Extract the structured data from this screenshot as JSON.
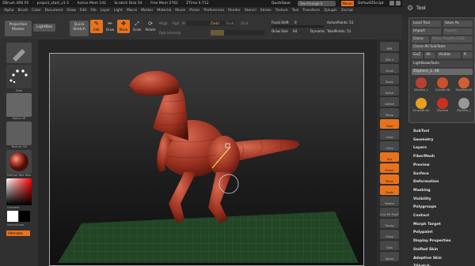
{
  "titlebar": {
    "app": "ZBrush 4R6 P2",
    "project": "project_start_v1-1",
    "active_mem": "Active Mem 142",
    "scratch_disk": "Scratch Disk 54",
    "free_mem": "Free Mem 2762",
    "ztime": "ZTime 0.712",
    "quicksave": "QuickSave",
    "see_through": "See-through 0",
    "menus": "Menus",
    "default_zscript": "DefaultZScript"
  },
  "menubar": [
    "Alpha",
    "Brush",
    "Color",
    "Document",
    "Draw",
    "Edit",
    "File",
    "Layer",
    "Light",
    "Macro",
    "Marker",
    "Material",
    "Movie",
    "Picker",
    "Preferences",
    "Render",
    "Stencil",
    "Stroke",
    "Texture",
    "Tool",
    "Transform",
    "Zplugin",
    "Zscript"
  ],
  "toolbar": {
    "projection_master": "Projection Master",
    "lightbox": "LightBox",
    "quick_sketch": "Quick Sketch",
    "edit": "Edit",
    "draw": "Draw",
    "move": "Move",
    "scale": "Scale",
    "rotate": "Rotate",
    "mrgb": "Mrgb",
    "rgb": "Rgb",
    "m": "M",
    "zadd": "Zadd",
    "zsub": "Zsub",
    "zcut": "Zcut",
    "rgb_intensity": "Rgb Intensity",
    "z_intensity": "Z Intensity",
    "z_intensity_value": 25,
    "focal_shift": "Focal Shift",
    "focal_shift_value": "0",
    "draw_size": "Draw Size",
    "draw_size_value": "64",
    "dynamic": "Dynamic",
    "active_points": "ActivePoints: 51",
    "total_points": "TotalPoints: 51"
  },
  "left": {
    "stroke_label": "Dots",
    "alpha_label": "Alpha Off",
    "texture_label": "Texture Off",
    "material_label": "MatCap Red Wax",
    "gradient": "Gradient",
    "switch_color": "SwitchColor",
    "alternate": "Alternate",
    "accent": "#e8721c"
  },
  "rightstrip": [
    "BPR",
    "SPix 3",
    "Scroll",
    "Zoom",
    "Actual",
    "AAHalf",
    "Persp",
    "Floor",
    "Local",
    "LSym",
    "Xyz",
    "Frame",
    "Move",
    "Scale",
    "Rotate",
    "Line Fill PolyF",
    "Transp",
    "Ghost",
    "Solo",
    "Xpose"
  ],
  "tool_panel": {
    "title": "Tool",
    "load_tool": "Load Tool",
    "save_as": "Save As",
    "import": "Import",
    "export": "Export",
    "clone": "Clone",
    "make_polymesh": "Make PolyMesh3D",
    "clone_all": "Clone All SubTools",
    "goz": "GoZ",
    "all": "All",
    "visible": "Visible",
    "r": "R",
    "lightbox_tools": "Lightbox▸Tools",
    "current_tool": "ZSphere_1. 48",
    "thumbs": [
      "ZSphere_1",
      "Cylinder3D",
      "PolyMesh3D",
      "SimpleBrush",
      "ZSphere",
      "ZSphere_1"
    ],
    "menu": [
      "SubTool",
      "Geometry",
      "Layers",
      "FiberMesh",
      "Preview",
      "Surface",
      "Deformation",
      "Masking",
      "Visibility",
      "Polygroups",
      "Contact",
      "Morph Target",
      "Polypaint",
      "Display Properties",
      "Unified Skin",
      "Adaptive Skin",
      "ZSketch"
    ]
  }
}
